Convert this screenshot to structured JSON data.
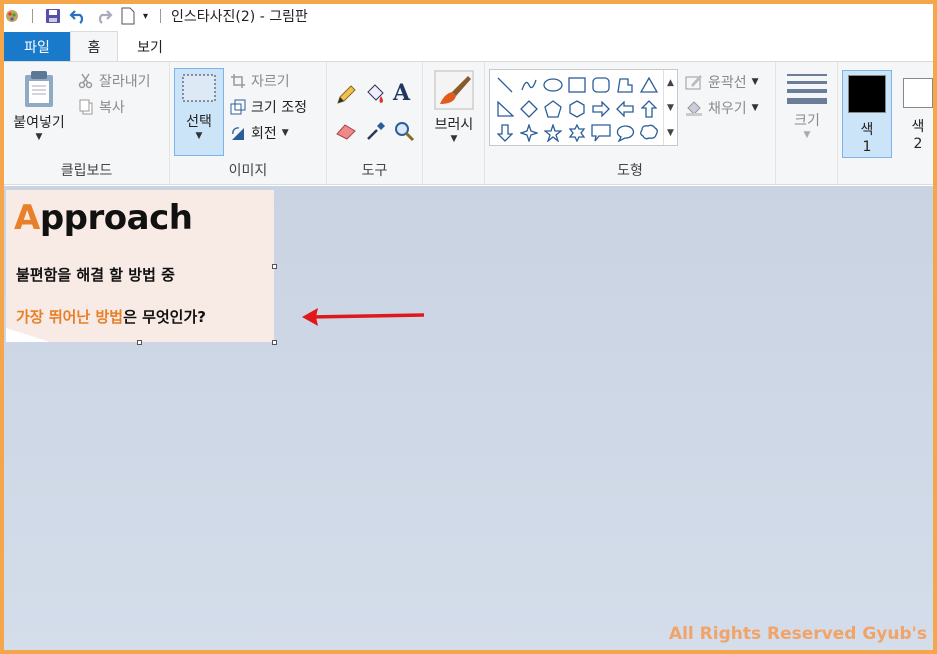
{
  "app": {
    "title": "인스타사진(2) - 그림판"
  },
  "tabs": [
    {
      "label": "파일"
    },
    {
      "label": "홈"
    },
    {
      "label": "보기"
    }
  ],
  "clipboard": {
    "paste": "붙여넣기",
    "cut": "잘라내기",
    "copy": "복사",
    "group": "클립보드"
  },
  "image": {
    "select": "선택",
    "crop": "자르기",
    "resize": "크기 조정",
    "rotate": "회전",
    "group": "이미지"
  },
  "tools": {
    "group": "도구"
  },
  "brushes": {
    "label": "브러시"
  },
  "shapes": {
    "outline": "윤곽선",
    "fill": "채우기",
    "group": "도형"
  },
  "size": {
    "label": "크기"
  },
  "colors": {
    "color1_label": "색",
    "color1_num": "1",
    "color2_label": "색",
    "color2_num": "2",
    "color1_value": "#000000",
    "color2_value": "#ffffff"
  },
  "canvas": {
    "heading_first": "A",
    "heading_rest": "pproach",
    "line1": "불편함을 해결 할 방법 중",
    "line2_orange_a": "가장 뛰어난 ",
    "line2_orange_b": "방법",
    "line2_rest": "은 무엇인가?"
  },
  "watermark": "All Rights Reserved Gyub's",
  "accent": {
    "file_tab": "#1979ca",
    "orange": "#e8802a",
    "arrow": "#e0181b",
    "border": "#f5a54a"
  }
}
